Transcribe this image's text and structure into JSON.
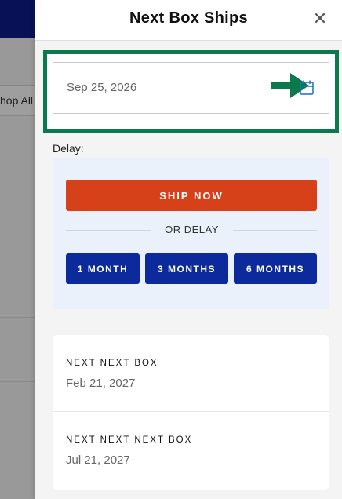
{
  "background": {
    "shop_all_label": "hop All"
  },
  "drawer": {
    "title": "Next Box Ships",
    "close_icon": "close-icon",
    "date_field": {
      "value": "Sep 25, 2026",
      "icon": "calendar-icon"
    },
    "delay_label": "Delay:",
    "ship_now_label": "SHIP NOW",
    "or_delay_label": "OR DELAY",
    "delay_options": [
      "1 MONTH",
      "3 MONTHS",
      "6 MONTHS"
    ],
    "upcoming": [
      {
        "label": "NEXT NEXT BOX",
        "date": "Feb 21, 2027"
      },
      {
        "label": "NEXT NEXT NEXT BOX",
        "date": "Jul 21, 2027"
      }
    ]
  },
  "colors": {
    "highlight": "#0a7a4e",
    "ship_now": "#d6411a",
    "delay_button": "#0c2a9c",
    "delay_panel": "#ebf1fa",
    "calendar_icon": "#1a6fc4"
  }
}
